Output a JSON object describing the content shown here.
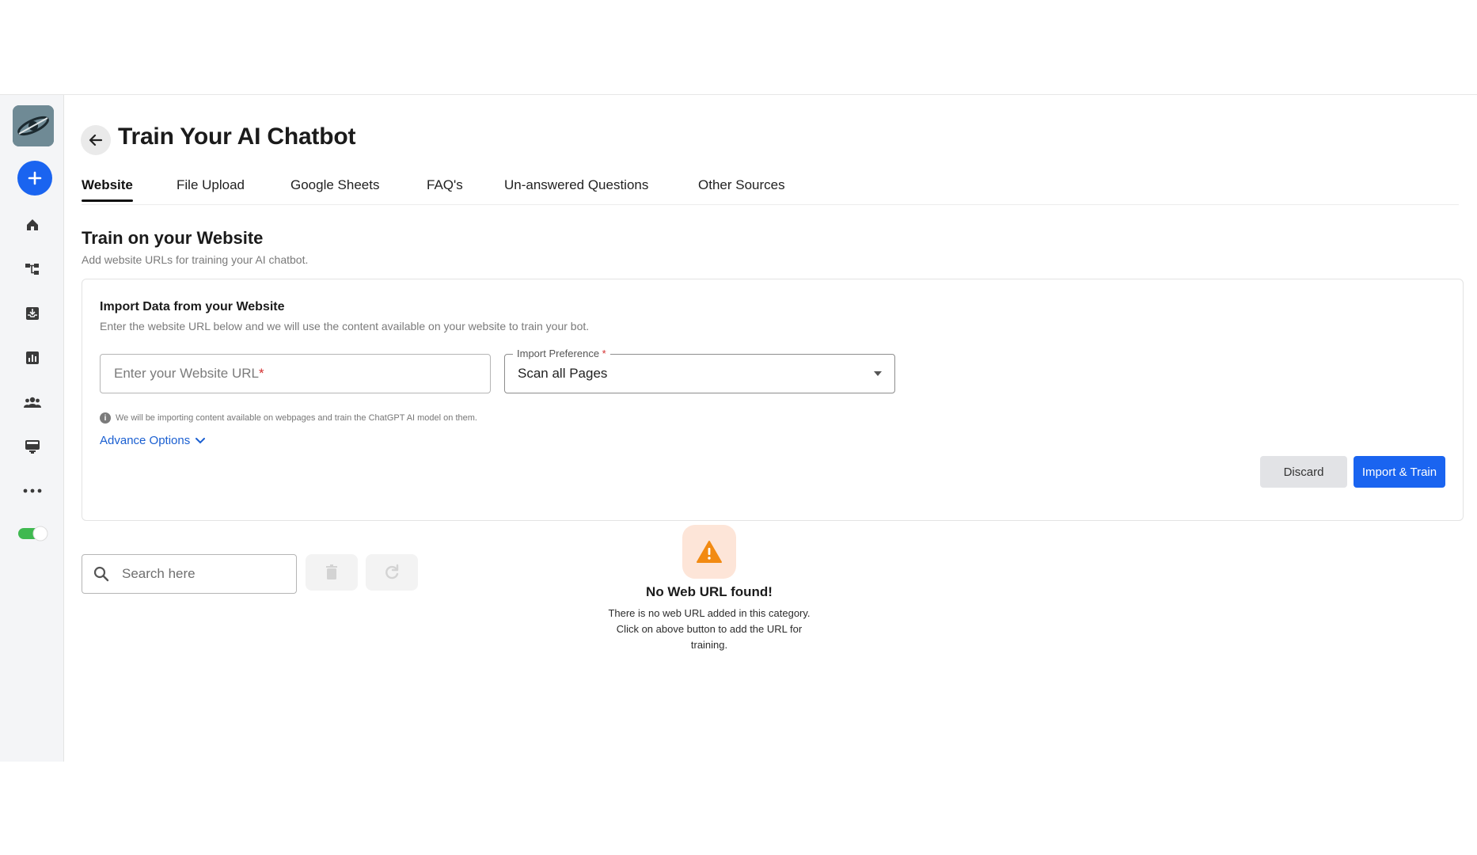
{
  "header": {
    "title": "Train Your AI Chatbot"
  },
  "tabs": [
    {
      "label": "Website",
      "active": true
    },
    {
      "label": "File Upload"
    },
    {
      "label": "Google Sheets"
    },
    {
      "label": "FAQ's"
    },
    {
      "label": "Un-answered Questions"
    },
    {
      "label": "Other Sources"
    }
  ],
  "section": {
    "title": "Train on your Website",
    "subtitle": "Add website URLs for training your AI chatbot."
  },
  "card": {
    "title": "Import Data from your Website",
    "subtitle": "Enter the website URL below and we will use the content available on your website to train your bot.",
    "url_placeholder": "Enter your Website URL",
    "required_mark": "*",
    "select_label": "Import Preference",
    "select_value": "Scan all Pages",
    "info_text": "We will be importing content available on webpages and train the ChatGPT AI model on them.",
    "advance_label": "Advance Options",
    "discard_label": "Discard",
    "import_label": "Import & Train"
  },
  "search": {
    "placeholder": "Search here"
  },
  "empty": {
    "title": "No Web URL found!",
    "text": "There is no web URL added in this category. Click on above button to add the URL for training."
  },
  "colors": {
    "accent": "#1a64f0",
    "toggle": "#3fb950",
    "warning": "#f28a12"
  }
}
